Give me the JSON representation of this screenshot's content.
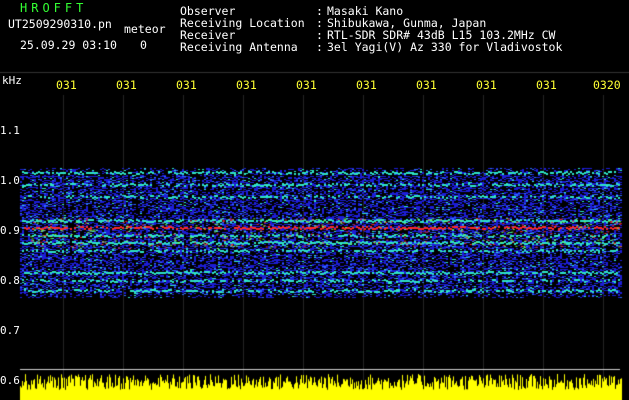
{
  "colors": {
    "background": "#000000",
    "brand": "#33ff33",
    "text": "#ffffff",
    "label_yellow": "#ffff33",
    "signal_blue": "#1d1dd8",
    "signal_cyan": "#2ee6c8",
    "signal_red": "#ff2a2a",
    "noise_floor_yellow": "#ffff00"
  },
  "header": {
    "brand": "HROFFT",
    "filename": "UT2509290310.pn",
    "meteor_tag": "meteor",
    "datetime": "25.09.29 03:10",
    "counter": "0"
  },
  "info": [
    {
      "key": "Observer",
      "sep": ":",
      "value": "Masaki Kano"
    },
    {
      "key": "Receiving Location",
      "sep": ":",
      "value": "Shibukawa, Gunma, Japan"
    },
    {
      "key": "Receiver",
      "sep": ":",
      "value": "RTL-SDR SDR# 43dB L15 103.2MHz CW"
    },
    {
      "key": "Receiving Antenna",
      "sep": ":",
      "value": "3el Yagi(V) Az 330 for Vladivostok"
    }
  ],
  "axis": {
    "y_unit": "kHz",
    "y_labels": [
      "1.1",
      "1.0",
      "0.9",
      "0.8",
      "0.7",
      "0.6"
    ],
    "x_labels": [
      "031",
      "031",
      "031",
      "031",
      "031",
      "031",
      "031",
      "031",
      "031",
      "0320"
    ]
  }
}
